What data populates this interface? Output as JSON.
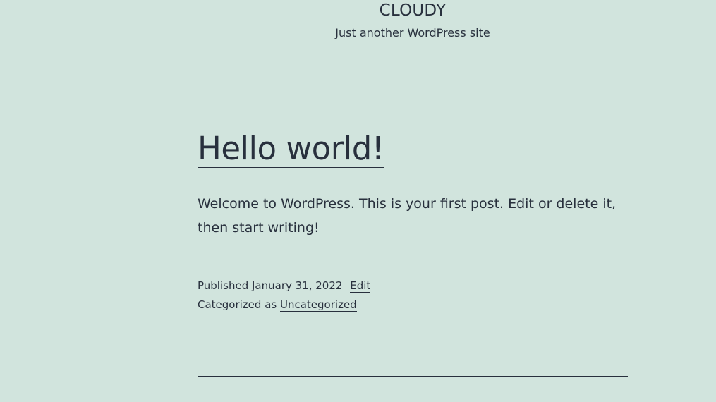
{
  "site": {
    "title": "CLOUDY",
    "description": "Just another WordPress site"
  },
  "post": {
    "title": "Hello world!",
    "content": "Welcome to WordPress. This is your first post. Edit or delete it, then start writing!",
    "meta": {
      "published_label": "Published",
      "date": "January 31, 2022",
      "edit_label": "Edit",
      "categorized_label": "Categorized as",
      "category": "Uncategorized"
    }
  },
  "colors": {
    "background": "#d1e4dd",
    "text": "#28303d"
  }
}
